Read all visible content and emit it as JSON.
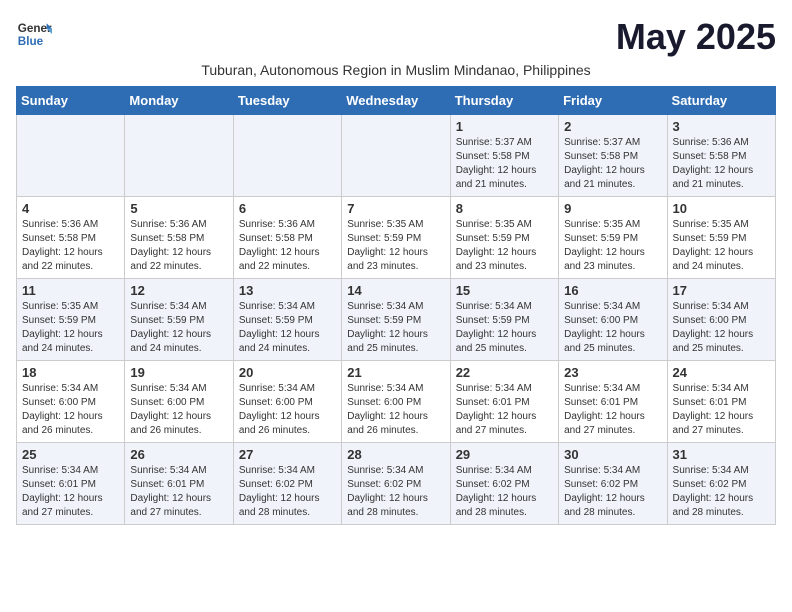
{
  "header": {
    "logo_line1": "General",
    "logo_line2": "Blue",
    "month_title": "May 2025",
    "subtitle": "Tuburan, Autonomous Region in Muslim Mindanao, Philippines"
  },
  "days_of_week": [
    "Sunday",
    "Monday",
    "Tuesday",
    "Wednesday",
    "Thursday",
    "Friday",
    "Saturday"
  ],
  "weeks": [
    [
      {
        "day": "",
        "info": ""
      },
      {
        "day": "",
        "info": ""
      },
      {
        "day": "",
        "info": ""
      },
      {
        "day": "",
        "info": ""
      },
      {
        "day": "1",
        "info": "Sunrise: 5:37 AM\nSunset: 5:58 PM\nDaylight: 12 hours\nand 21 minutes."
      },
      {
        "day": "2",
        "info": "Sunrise: 5:37 AM\nSunset: 5:58 PM\nDaylight: 12 hours\nand 21 minutes."
      },
      {
        "day": "3",
        "info": "Sunrise: 5:36 AM\nSunset: 5:58 PM\nDaylight: 12 hours\nand 21 minutes."
      }
    ],
    [
      {
        "day": "4",
        "info": "Sunrise: 5:36 AM\nSunset: 5:58 PM\nDaylight: 12 hours\nand 22 minutes."
      },
      {
        "day": "5",
        "info": "Sunrise: 5:36 AM\nSunset: 5:58 PM\nDaylight: 12 hours\nand 22 minutes."
      },
      {
        "day": "6",
        "info": "Sunrise: 5:36 AM\nSunset: 5:58 PM\nDaylight: 12 hours\nand 22 minutes."
      },
      {
        "day": "7",
        "info": "Sunrise: 5:35 AM\nSunset: 5:59 PM\nDaylight: 12 hours\nand 23 minutes."
      },
      {
        "day": "8",
        "info": "Sunrise: 5:35 AM\nSunset: 5:59 PM\nDaylight: 12 hours\nand 23 minutes."
      },
      {
        "day": "9",
        "info": "Sunrise: 5:35 AM\nSunset: 5:59 PM\nDaylight: 12 hours\nand 23 minutes."
      },
      {
        "day": "10",
        "info": "Sunrise: 5:35 AM\nSunset: 5:59 PM\nDaylight: 12 hours\nand 24 minutes."
      }
    ],
    [
      {
        "day": "11",
        "info": "Sunrise: 5:35 AM\nSunset: 5:59 PM\nDaylight: 12 hours\nand 24 minutes."
      },
      {
        "day": "12",
        "info": "Sunrise: 5:34 AM\nSunset: 5:59 PM\nDaylight: 12 hours\nand 24 minutes."
      },
      {
        "day": "13",
        "info": "Sunrise: 5:34 AM\nSunset: 5:59 PM\nDaylight: 12 hours\nand 24 minutes."
      },
      {
        "day": "14",
        "info": "Sunrise: 5:34 AM\nSunset: 5:59 PM\nDaylight: 12 hours\nand 25 minutes."
      },
      {
        "day": "15",
        "info": "Sunrise: 5:34 AM\nSunset: 5:59 PM\nDaylight: 12 hours\nand 25 minutes."
      },
      {
        "day": "16",
        "info": "Sunrise: 5:34 AM\nSunset: 6:00 PM\nDaylight: 12 hours\nand 25 minutes."
      },
      {
        "day": "17",
        "info": "Sunrise: 5:34 AM\nSunset: 6:00 PM\nDaylight: 12 hours\nand 25 minutes."
      }
    ],
    [
      {
        "day": "18",
        "info": "Sunrise: 5:34 AM\nSunset: 6:00 PM\nDaylight: 12 hours\nand 26 minutes."
      },
      {
        "day": "19",
        "info": "Sunrise: 5:34 AM\nSunset: 6:00 PM\nDaylight: 12 hours\nand 26 minutes."
      },
      {
        "day": "20",
        "info": "Sunrise: 5:34 AM\nSunset: 6:00 PM\nDaylight: 12 hours\nand 26 minutes."
      },
      {
        "day": "21",
        "info": "Sunrise: 5:34 AM\nSunset: 6:00 PM\nDaylight: 12 hours\nand 26 minutes."
      },
      {
        "day": "22",
        "info": "Sunrise: 5:34 AM\nSunset: 6:01 PM\nDaylight: 12 hours\nand 27 minutes."
      },
      {
        "day": "23",
        "info": "Sunrise: 5:34 AM\nSunset: 6:01 PM\nDaylight: 12 hours\nand 27 minutes."
      },
      {
        "day": "24",
        "info": "Sunrise: 5:34 AM\nSunset: 6:01 PM\nDaylight: 12 hours\nand 27 minutes."
      }
    ],
    [
      {
        "day": "25",
        "info": "Sunrise: 5:34 AM\nSunset: 6:01 PM\nDaylight: 12 hours\nand 27 minutes."
      },
      {
        "day": "26",
        "info": "Sunrise: 5:34 AM\nSunset: 6:01 PM\nDaylight: 12 hours\nand 27 minutes."
      },
      {
        "day": "27",
        "info": "Sunrise: 5:34 AM\nSunset: 6:02 PM\nDaylight: 12 hours\nand 28 minutes."
      },
      {
        "day": "28",
        "info": "Sunrise: 5:34 AM\nSunset: 6:02 PM\nDaylight: 12 hours\nand 28 minutes."
      },
      {
        "day": "29",
        "info": "Sunrise: 5:34 AM\nSunset: 6:02 PM\nDaylight: 12 hours\nand 28 minutes."
      },
      {
        "day": "30",
        "info": "Sunrise: 5:34 AM\nSunset: 6:02 PM\nDaylight: 12 hours\nand 28 minutes."
      },
      {
        "day": "31",
        "info": "Sunrise: 5:34 AM\nSunset: 6:02 PM\nDaylight: 12 hours\nand 28 minutes."
      }
    ]
  ]
}
